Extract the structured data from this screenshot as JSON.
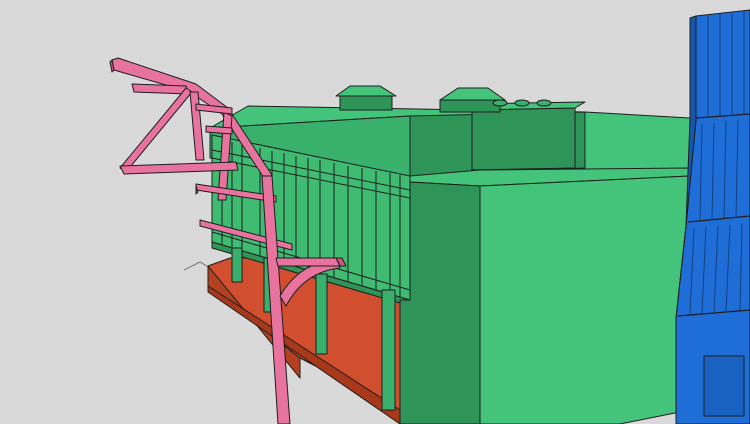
{
  "viewport": {
    "title": ""
  },
  "palette": {
    "background": "#d9d9d9",
    "edge": "#1e1e1e",
    "green_light": "#43c47a",
    "green_mid": "#39b06c",
    "green_dark": "#2e9458",
    "green_deep": "#258049",
    "red_ground": "#d14f2f",
    "red_dark": "#b3401f",
    "pink": "#e8739f",
    "pink_dark": "#c95680",
    "blue": "#1f6ed8",
    "blue_dark": "#1656ad"
  },
  "objects": [
    {
      "name": "green-building",
      "kind": "model"
    },
    {
      "name": "pink-truss-frame",
      "kind": "model"
    },
    {
      "name": "blue-tower",
      "kind": "model"
    },
    {
      "name": "red-ground-plinth",
      "kind": "model"
    }
  ]
}
